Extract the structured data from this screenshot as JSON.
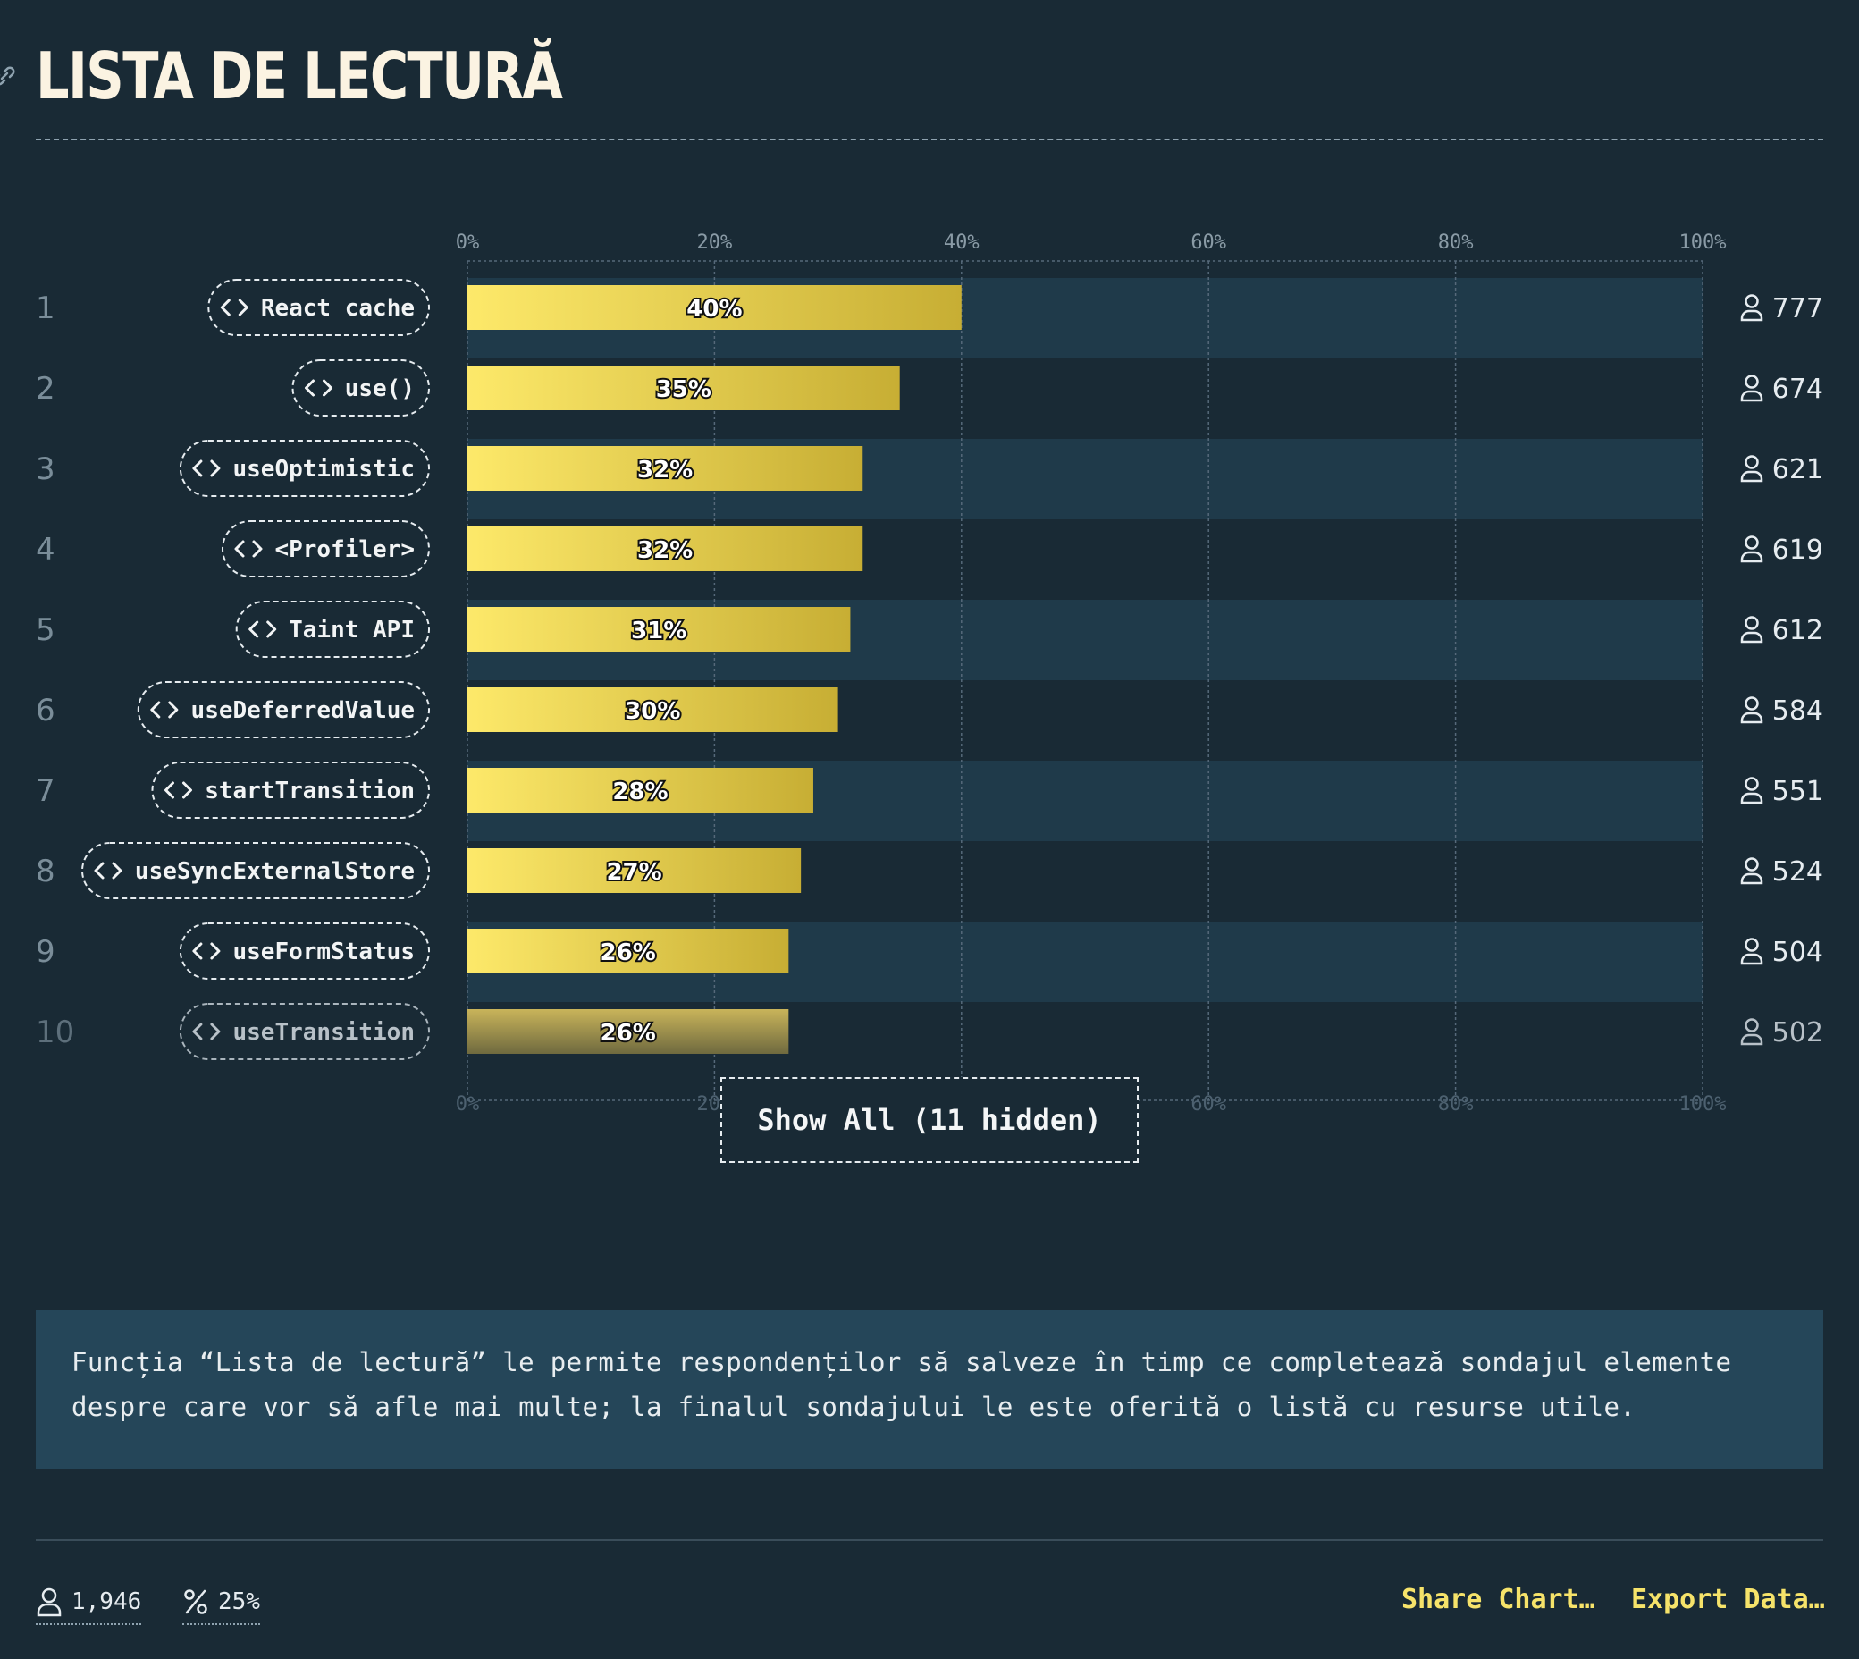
{
  "page": {
    "title": "LISTA DE LECTURĂ",
    "show_all_label": "Show All (11 hidden)",
    "description": "Funcția “Lista de lectură” le permite respondenților să salveze în timp ce completează sondajul elemente despre care vor să afle mai multe; la finalul sondajului le este oferită o listă cu resurse utile.",
    "footer": {
      "respondents": "1,946",
      "percent": "25%",
      "share_label": "Share Chart…",
      "export_label": "Export Data…"
    }
  },
  "icons": {
    "link": "link-icon",
    "code": "code-icon",
    "user": "user-icon",
    "percent": "percent-icon"
  },
  "colors": {
    "background": "#192a35",
    "row_band": "#1f3a4a",
    "bar_start": "#fde96a",
    "bar_end": "#c7ae34",
    "accent": "#f6e36a",
    "description_bg": "#254659"
  },
  "chart_data": {
    "type": "bar",
    "orientation": "horizontal",
    "xlim": [
      0,
      100
    ],
    "tick_labels": [
      "0%",
      "20%",
      "40%",
      "60%",
      "80%",
      "100%"
    ],
    "grid": true,
    "categories": [
      "React cache",
      "use()",
      "useOptimistic",
      "<Profiler>",
      "Taint API",
      "useDeferredValue",
      "startTransition",
      "useSyncExternalStore",
      "useFormStatus",
      "useTransition"
    ],
    "ranks": [
      "1",
      "2",
      "3",
      "4",
      "5",
      "6",
      "7",
      "8",
      "9",
      "10"
    ],
    "values": [
      40,
      35,
      32,
      32,
      31,
      30,
      28,
      27,
      26,
      26
    ],
    "value_labels": [
      "40%",
      "35%",
      "32%",
      "32%",
      "31%",
      "30%",
      "28%",
      "27%",
      "26%",
      "26%"
    ],
    "counts": [
      "777",
      "674",
      "621",
      "619",
      "612",
      "584",
      "551",
      "524",
      "504",
      "502"
    ]
  }
}
